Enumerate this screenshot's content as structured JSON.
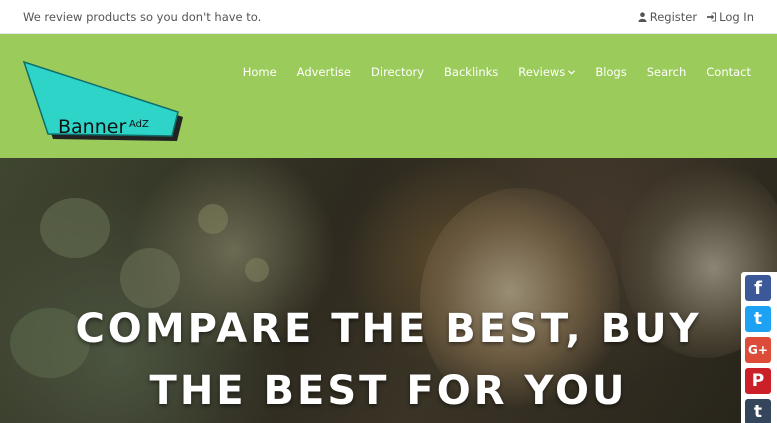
{
  "topbar": {
    "tagline": "We review products so you don't have to.",
    "register_label": "Register",
    "login_label": "Log In"
  },
  "logo": {
    "main_text": "Banner",
    "sub_text": "AdZ"
  },
  "nav": {
    "items": [
      {
        "label": "Home"
      },
      {
        "label": "Advertise"
      },
      {
        "label": "Directory"
      },
      {
        "label": "Backlinks"
      },
      {
        "label": "Reviews"
      },
      {
        "label": "Blogs"
      },
      {
        "label": "Search"
      },
      {
        "label": "Contact"
      }
    ]
  },
  "hero": {
    "line1": "COMPARE THE BEST, BUY",
    "line2": "THE BEST FOR YOU"
  },
  "social": {
    "items": [
      {
        "icon": "facebook-icon",
        "glyph": "f",
        "color": "#3b5998"
      },
      {
        "icon": "twitter-icon",
        "glyph": "t",
        "color": "#1da1f2"
      },
      {
        "icon": "google-plus-icon",
        "glyph": "G+",
        "color": "#dd4b39"
      },
      {
        "icon": "pinterest-icon",
        "glyph": "P",
        "color": "#cb2027"
      },
      {
        "icon": "tumblr-icon",
        "glyph": "t",
        "color": "#35465c"
      }
    ]
  },
  "colors": {
    "header_green": "#9bcb5a",
    "logo_teal": "#2ed4c8"
  }
}
